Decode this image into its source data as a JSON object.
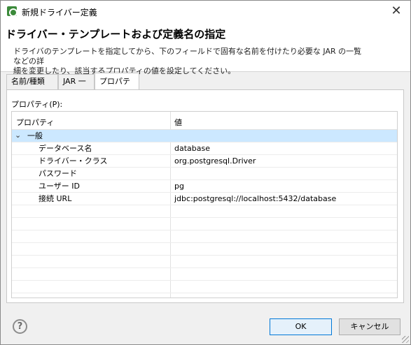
{
  "window": {
    "title": "新規ドライバー定義",
    "close_symbol": "✕"
  },
  "header": {
    "title": "ドライバー・テンプレートおよび定義名の指定",
    "description_line1": "ドライバのテンプレートを指定してから、下のフィールドで固有な名前を付けたり必要な JAR の一覧などの詳",
    "description_line2": "細を変更したり、該当するプロパティの値を設定してください。"
  },
  "tabs": [
    {
      "label": "名前/種類",
      "active": false
    },
    {
      "label": "JAR 一覧",
      "active": false
    },
    {
      "label": "プロパティー",
      "active": true
    }
  ],
  "properties": {
    "section_label": "プロパティ(P):",
    "columns": [
      "プロパティ",
      "値"
    ],
    "group": {
      "label": "一般",
      "expanded": true
    },
    "rows": [
      {
        "name": "データベース名",
        "value": "database"
      },
      {
        "name": "ドライバー・クラス",
        "value": "org.postgresql.Driver"
      },
      {
        "name": "パスワード",
        "value": ""
      },
      {
        "name": "ユーザー ID",
        "value": "pg"
      },
      {
        "name": "接続 URL",
        "value": "jdbc:postgresql://localhost:5432/database"
      }
    ]
  },
  "footer": {
    "help_symbol": "?",
    "ok_label": "OK",
    "cancel_label": "キャンセル"
  }
}
